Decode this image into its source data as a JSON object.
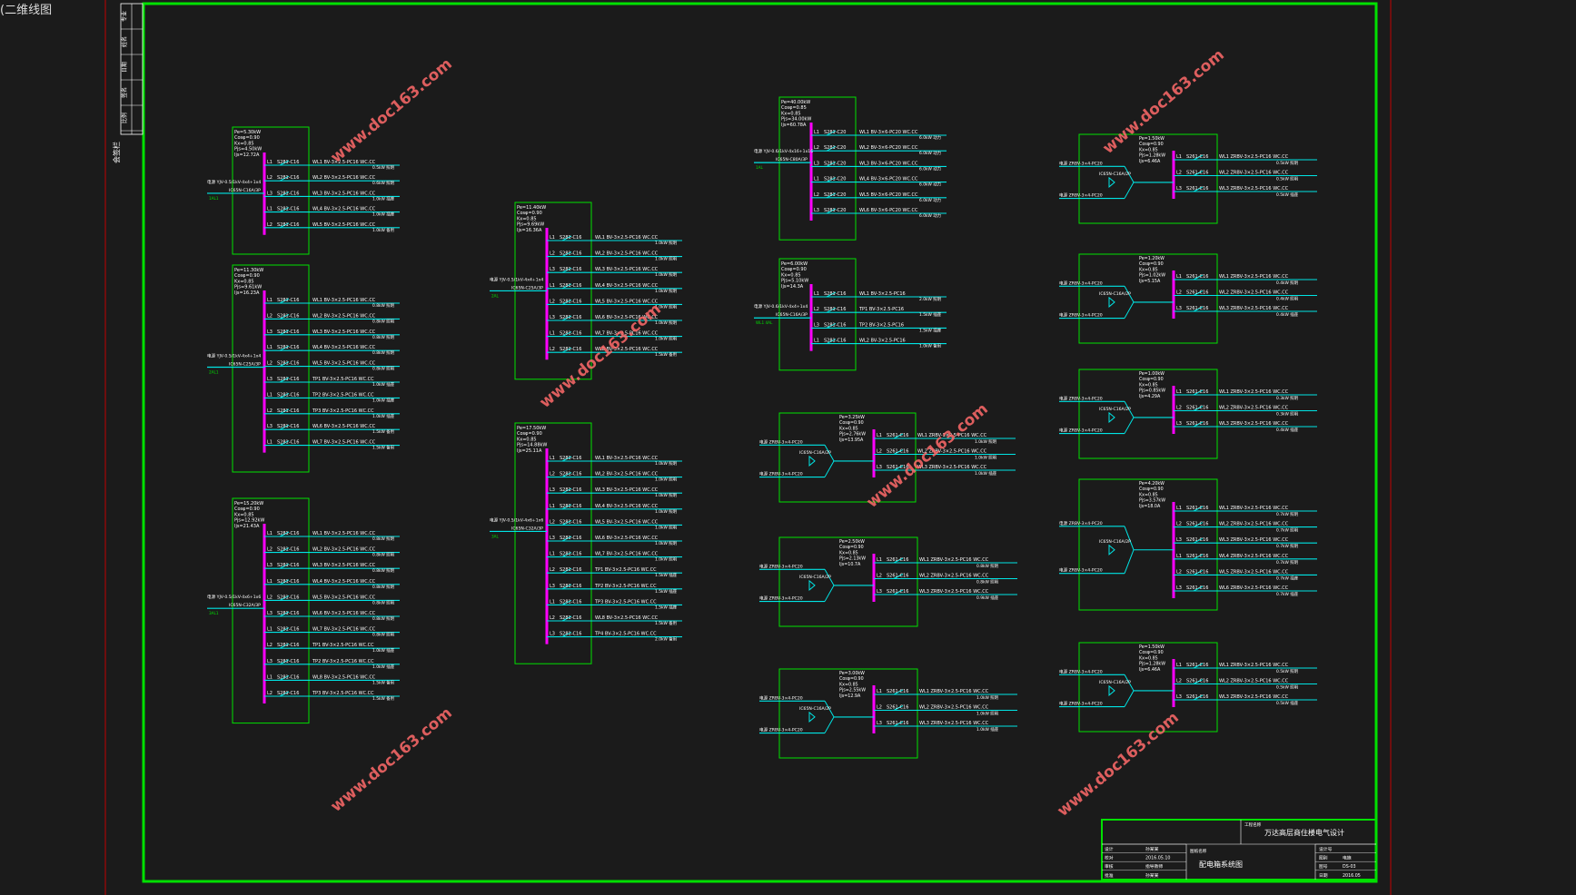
{
  "tab_label": "(二维线图",
  "colors": {
    "background": "#1b1b1b",
    "border": "#00e000",
    "busbar": "#ff00ff",
    "feeder": "#00e5e5",
    "text": "#ffffff",
    "watermark": "#ff6a6a",
    "sheet_edge": "#c00000"
  },
  "watermark": "www.doc163.com",
  "left_strip": {
    "label_side": "会签栏",
    "cells": [
      "专业",
      "姓名",
      "日期",
      "签名",
      "比例"
    ]
  },
  "panels": [
    {
      "id": "AL-1",
      "params": [
        "Pe=5.30kW",
        "Cosφ=0.90",
        "Kx=0.85",
        "Pjs=4.50kW",
        "Ijs=12.72A"
      ],
      "incoming": "电源 YJV-0.5/1kV-4x4+1x4",
      "main_breaker": "IC65N-C16A/3P",
      "input_label": "1AL1",
      "circuits": [
        {
          "phase": "L1",
          "breaker": "S281-C16",
          "cable": "WL1 BV-3×2.5-PC16 WC.CC",
          "load": "0.5kW 照明"
        },
        {
          "phase": "L2",
          "breaker": "S281-C16",
          "cable": "WL2 BV-3×2.5-PC16 WC.CC",
          "load": "0.6kW 照明"
        },
        {
          "phase": "L3",
          "breaker": "S281-C16",
          "cable": "WL3 BV-3×2.5-PC16 WC.CC",
          "load": "1.0kW 插座"
        },
        {
          "phase": "L1",
          "breaker": "S281-C16",
          "cable": "WL4 BV-3×2.5-PC16 WC.CC",
          "load": "1.0kW 插座"
        },
        {
          "phase": "L2",
          "breaker": "S281-C16",
          "cable": "WL5 BV-3×2.5-PC16 WC.CC",
          "load": "1.0kW 备用"
        }
      ]
    },
    {
      "id": "AL-2",
      "params": [
        "Pe=11.30kW",
        "Cosφ=0.90",
        "Kx=0.85",
        "Pjs=9.61kW",
        "Ijs=16.23A"
      ],
      "incoming": "电源 YJV-0.5/1kV-4x4+1x4",
      "main_breaker": "IC65N-C25A/3P",
      "input_label": "2AL1",
      "circuits": [
        {
          "phase": "L1",
          "breaker": "S281-C16",
          "cable": "WL1 BV-3×2.5-PC16 WC.CC",
          "load": "0.8kW 照明"
        },
        {
          "phase": "L2",
          "breaker": "S281-C16",
          "cable": "WL2 BV-3×2.5-PC16 WC.CC",
          "load": "0.8kW 照明"
        },
        {
          "phase": "L3",
          "breaker": "S281-C16",
          "cable": "WL3 BV-3×2.5-PC16 WC.CC",
          "load": "0.8kW 照明"
        },
        {
          "phase": "L1",
          "breaker": "S281-C16",
          "cable": "WL4 BV-3×2.5-PC16 WC.CC",
          "load": "0.8kW 照明"
        },
        {
          "phase": "L2",
          "breaker": "S281-C16",
          "cable": "WL5 BV-3×2.5-PC16 WC.CC",
          "load": "0.8kW 照明"
        },
        {
          "phase": "L3",
          "breaker": "S281-C16",
          "cable": "TP1 BV-3×2.5-PC16 WC.CC",
          "load": "1.0kW 插座"
        },
        {
          "phase": "L1",
          "breaker": "S281-C16",
          "cable": "TP2 BV-3×2.5-PC16 WC.CC",
          "load": "1.0kW 插座"
        },
        {
          "phase": "L2",
          "breaker": "S281-C16",
          "cable": "TP3 BV-3×2.5-PC16 WC.CC",
          "load": "1.0kW 插座"
        },
        {
          "phase": "L3",
          "breaker": "S281-C16",
          "cable": "WL6 BV-3×2.5-PC16 WC.CC",
          "load": "1.5kW 备用"
        },
        {
          "phase": "L1",
          "breaker": "S281-C16",
          "cable": "WL7 BV-3×2.5-PC16 WC.CC",
          "load": "1.5kW 备用"
        }
      ]
    },
    {
      "id": "AL-3",
      "params": [
        "Pe=15.20kW",
        "Cosφ=0.90",
        "Kx=0.85",
        "Pjs=12.92kW",
        "Ijs=21.43A"
      ],
      "incoming": "电源 YJV-0.5/1kV-4x6+1x6",
      "main_breaker": "IC65N-C32A/3P",
      "input_label": "3AL1",
      "circuits": [
        {
          "phase": "L1",
          "breaker": "S281-C16",
          "cable": "WL1 BV-3×2.5-PC16 WC.CC",
          "load": "0.8kW 照明"
        },
        {
          "phase": "L2",
          "breaker": "S281-C16",
          "cable": "WL2 BV-3×2.5-PC16 WC.CC",
          "load": "0.8kW 照明"
        },
        {
          "phase": "L3",
          "breaker": "S281-C16",
          "cable": "WL3 BV-3×2.5-PC16 WC.CC",
          "load": "0.8kW 照明"
        },
        {
          "phase": "L1",
          "breaker": "S281-C16",
          "cable": "WL4 BV-3×2.5-PC16 WC.CC",
          "load": "0.8kW 照明"
        },
        {
          "phase": "L2",
          "breaker": "S281-C16",
          "cable": "WL5 BV-3×2.5-PC16 WC.CC",
          "load": "0.8kW 照明"
        },
        {
          "phase": "L3",
          "breaker": "S281-C16",
          "cable": "WL6 BV-3×2.5-PC16 WC.CC",
          "load": "0.8kW 照明"
        },
        {
          "phase": "L1",
          "breaker": "S281-C16",
          "cable": "WL7 BV-3×2.5-PC16 WC.CC",
          "load": "0.8kW 照明"
        },
        {
          "phase": "L2",
          "breaker": "S281-C16",
          "cable": "TP1 BV-3×2.5-PC16 WC.CC",
          "load": "1.0kW 插座"
        },
        {
          "phase": "L3",
          "breaker": "S281-C16",
          "cable": "TP2 BV-3×2.5-PC16 WC.CC",
          "load": "1.0kW 插座"
        },
        {
          "phase": "L1",
          "breaker": "S281-C16",
          "cable": "WL8 BV-3×2.5-PC16 WC.CC",
          "load": "1.5kW 备用"
        },
        {
          "phase": "L2",
          "breaker": "S281-C16",
          "cable": "TP3 BV-3×2.5-PC16 WC.CC",
          "load": "1.5kW 备用"
        }
      ]
    },
    {
      "id": "AL-4",
      "params": [
        "Pe=11.40kW",
        "Cosφ=0.90",
        "Kx=0.85",
        "Pjs=9.69kW",
        "Ijs=16.36A"
      ],
      "incoming": "电源 YJV-0.5/1kV-4x4+1x4",
      "main_breaker": "IC65N-C25A/3P",
      "input_label": "2AL",
      "circuits": [
        {
          "phase": "L1",
          "breaker": "S281-C16",
          "cable": "WL1 BV-3×2.5-PC16 WC.CC",
          "load": "1.0kW 照明"
        },
        {
          "phase": "L2",
          "breaker": "S281-C16",
          "cable": "WL2 BV-3×2.5-PC16 WC.CC",
          "load": "1.0kW 照明"
        },
        {
          "phase": "L3",
          "breaker": "S281-C16",
          "cable": "WL3 BV-3×2.5-PC16 WC.CC",
          "load": "1.0kW 照明"
        },
        {
          "phase": "L1",
          "breaker": "S281-C16",
          "cable": "WL4 BV-3×2.5-PC16 WC.CC",
          "load": "1.0kW 照明"
        },
        {
          "phase": "L2",
          "breaker": "S281-C16",
          "cable": "WL5 BV-3×2.5-PC16 WC.CC",
          "load": "1.0kW 照明"
        },
        {
          "phase": "L3",
          "breaker": "S281-C16",
          "cable": "WL6 BV-3×2.5-PC16 WC.CC",
          "load": "1.0kW 照明"
        },
        {
          "phase": "L1",
          "breaker": "S281-C16",
          "cable": "WL7 BV-3×2.5-PC16 WC.CC",
          "load": "1.0kW 照明"
        },
        {
          "phase": "L2",
          "breaker": "S281-C16",
          "cable": "WL8 BV-3×2.5-PC16 WC.CC",
          "load": "1.5kW 备用"
        }
      ]
    },
    {
      "id": "AL-5",
      "params": [
        "Pe=17.50kW",
        "Cosφ=0.90",
        "Kx=0.85",
        "Pjs=14.88kW",
        "Ijs=25.11A"
      ],
      "incoming": "电源 YJV-0.5/1kV-4x6+1x6",
      "main_breaker": "IC65N-C32A/3P",
      "input_label": "3AL",
      "circuits": [
        {
          "phase": "L1",
          "breaker": "S281-C16",
          "cable": "WL1 BV-3×2.5-PC16 WC.CC",
          "load": "1.0kW 照明"
        },
        {
          "phase": "L2",
          "breaker": "S281-C16",
          "cable": "WL2 BV-3×2.5-PC16 WC.CC",
          "load": "1.0kW 照明"
        },
        {
          "phase": "L3",
          "breaker": "S281-C16",
          "cable": "WL3 BV-3×2.5-PC16 WC.CC",
          "load": "1.0kW 照明"
        },
        {
          "phase": "L1",
          "breaker": "S281-C16",
          "cable": "WL4 BV-3×2.5-PC16 WC.CC",
          "load": "1.0kW 照明"
        },
        {
          "phase": "L2",
          "breaker": "S281-C16",
          "cable": "WL5 BV-3×2.5-PC16 WC.CC",
          "load": "1.0kW 照明"
        },
        {
          "phase": "L3",
          "breaker": "S281-C16",
          "cable": "WL6 BV-3×2.5-PC16 WC.CC",
          "load": "1.0kW 照明"
        },
        {
          "phase": "L1",
          "breaker": "S281-C16",
          "cable": "WL7 BV-3×2.5-PC16 WC.CC",
          "load": "1.0kW 照明"
        },
        {
          "phase": "L2",
          "breaker": "S281-C16",
          "cable": "TP1 BV-3×2.5-PC16 WC.CC",
          "load": "1.5kW 插座"
        },
        {
          "phase": "L3",
          "breaker": "S281-C16",
          "cable": "TP2 BV-3×2.5-PC16 WC.CC",
          "load": "1.5kW 插座"
        },
        {
          "phase": "L1",
          "breaker": "S281-C16",
          "cable": "TP3 BV-3×2.5-PC16 WC.CC",
          "load": "1.5kW 插座"
        },
        {
          "phase": "L2",
          "breaker": "S281-C16",
          "cable": "WL8 BV-3×2.5-PC16 WC.CC",
          "load": "1.5kW 备用"
        },
        {
          "phase": "L3",
          "breaker": "S281-C16",
          "cable": "TP4 BV-3×2.5-PC16 WC.CC",
          "load": "2.0kW 备用"
        }
      ]
    },
    {
      "id": "AL-6",
      "params": [
        "Pe=40.00kW",
        "Cosφ=0.85",
        "Kx=0.85",
        "Pjs=34.00kW",
        "Ijs=60.78A"
      ],
      "incoming": "电源 YJV-0.6/1kV-4x16+1x16",
      "main_breaker": "IC65N-C80A/3P",
      "input_label": "1AL",
      "circuits": [
        {
          "phase": "L1",
          "breaker": "S281-C20",
          "cable": "WL1 BV-3×6-PC20 WC.CC",
          "load": "6.0kW 动力"
        },
        {
          "phase": "L2",
          "breaker": "S281-C20",
          "cable": "WL2 BV-3×6-PC20 WC.CC",
          "load": "6.0kW 动力"
        },
        {
          "phase": "L3",
          "breaker": "S281-C20",
          "cable": "WL3 BV-3×6-PC20 WC.CC",
          "load": "6.0kW 动力"
        },
        {
          "phase": "L1",
          "breaker": "S281-C20",
          "cable": "WL4 BV-3×6-PC20 WC.CC",
          "load": "6.0kW 动力"
        },
        {
          "phase": "L2",
          "breaker": "S281-C20",
          "cable": "WL5 BV-3×6-PC20 WC.CC",
          "load": "6.0kW 动力"
        },
        {
          "phase": "L3",
          "breaker": "S281-C20",
          "cable": "WL6 BV-3×6-PC20 WC.CC",
          "load": "6.0kW 动力"
        }
      ]
    },
    {
      "id": "AL-7",
      "params": [
        "Pe=6.00kW",
        "Cosφ=0.90",
        "Kx=0.85",
        "Pjs=5.10kW",
        "Ijs=14.3A"
      ],
      "incoming": "电源 YJV-0.6/1kV-4x4+1x4",
      "main_breaker": "IC65N-C16A/3P",
      "input_label": "WL1 4AL",
      "circuits": [
        {
          "phase": "L1",
          "breaker": "S281-C16",
          "cable": "WL1 BV-3×2.5-PC16",
          "load": "2.0kW 照明"
        },
        {
          "phase": "L2",
          "breaker": "S281-C16",
          "cable": "TP1 BV-3×2.5-PC16",
          "load": "1.5kW 插座"
        },
        {
          "phase": "L3",
          "breaker": "S281-C16",
          "cable": "TP2 BV-3×2.5-PC16",
          "load": "1.5kW 插座"
        },
        {
          "phase": "L1",
          "breaker": "S281-C16",
          "cable": "WL2 BV-3×2.5-PC16",
          "load": "1.0kW 备用"
        }
      ]
    }
  ],
  "small_panels": [
    {
      "id": "S1",
      "params": [
        "Pe=3.25kW",
        "Cosφ=0.90",
        "Kx=0.85",
        "Pjs=2.76kW",
        "Ijs=13.95A"
      ],
      "feeds": [
        "电源 ZRBV-3×4-PC20",
        "电源 ZRBV-3×4-PC20"
      ],
      "switch": "IC65N-C16A/2P",
      "circuits": [
        {
          "phase": "L1",
          "breaker": "S261-C16",
          "cable": "WL1 ZRBV-3×2.5-PC16 WC.CC",
          "load": "1.0kW 照明"
        },
        {
          "phase": "L2",
          "breaker": "S261-C16",
          "cable": "WL2 ZRBV-3×2.5-PC16 WC.CC",
          "load": "1.0kW 照明"
        },
        {
          "phase": "L3",
          "breaker": "S261-C16",
          "cable": "WL3 ZRBV-3×2.5-PC16 WC.CC",
          "load": "1.0kW 插座"
        }
      ]
    },
    {
      "id": "S2",
      "params": [
        "Pe=2.50kW",
        "Cosφ=0.90",
        "Kx=0.85",
        "Pjs=2.13kW",
        "Ijs=10.7A"
      ],
      "feeds": [
        "电源 ZRBV-3×4-PC20",
        "电源 ZRBV-3×4-PC20"
      ],
      "switch": "IC65N-C16A/2P",
      "circuits": [
        {
          "phase": "L1",
          "breaker": "S261-C16",
          "cable": "WL1 ZRBV-3×2.5-PC16 WC.CC",
          "load": "0.8kW 照明"
        },
        {
          "phase": "L2",
          "breaker": "S261-C16",
          "cable": "WL2 ZRBV-3×2.5-PC16 WC.CC",
          "load": "0.8kW 照明"
        },
        {
          "phase": "L3",
          "breaker": "S261-C16",
          "cable": "WL3 ZRBV-3×2.5-PC16 WC.CC",
          "load": "0.9kW 插座"
        }
      ]
    },
    {
      "id": "S3",
      "params": [
        "Pe=3.00kW",
        "Cosφ=0.90",
        "Kx=0.85",
        "Pjs=2.55kW",
        "Ijs=12.9A"
      ],
      "feeds": [
        "电源 ZRBV-3×4-PC20",
        "电源 ZRBV-3×4-PC20"
      ],
      "switch": "IC65N-C16A/2P",
      "circuits": [
        {
          "phase": "L1",
          "breaker": "S261-C16",
          "cable": "WL1 ZRBV-3×2.5-PC16 WC.CC",
          "load": "1.0kW 照明"
        },
        {
          "phase": "L2",
          "breaker": "S261-C16",
          "cable": "WL2 ZRBV-3×2.5-PC16 WC.CC",
          "load": "1.0kW 照明"
        },
        {
          "phase": "L3",
          "breaker": "S261-C16",
          "cable": "WL3 ZRBV-3×2.5-PC16 WC.CC",
          "load": "1.0kW 插座"
        }
      ]
    },
    {
      "id": "S4",
      "params": [
        "Pe=1.50kW",
        "Cosφ=0.90",
        "Kx=0.85",
        "Pjs=1.28kW",
        "Ijs=6.46A"
      ],
      "feeds": [
        "电源 ZRBV-3×4-PC20",
        "电源 ZRBV-3×4-PC20"
      ],
      "switch": "IC65N-C16A/2P",
      "circuits": [
        {
          "phase": "L1",
          "breaker": "S261-C16",
          "cable": "WL1 ZRBV-3×2.5-PC16 WC.CC",
          "load": "0.5kW 照明"
        },
        {
          "phase": "L2",
          "breaker": "S261-C16",
          "cable": "WL2 ZRBV-3×2.5-PC16 WC.CC",
          "load": "0.5kW 照明"
        },
        {
          "phase": "L3",
          "breaker": "S261-C16",
          "cable": "WL3 ZRBV-3×2.5-PC16 WC.CC",
          "load": "0.5kW 插座"
        }
      ]
    },
    {
      "id": "S5",
      "params": [
        "Pe=1.20kW",
        "Cosφ=0.90",
        "Kx=0.85",
        "Pjs=1.02kW",
        "Ijs=5.15A"
      ],
      "feeds": [
        "电源 ZRBV-3×4-PC20",
        "电源 ZRBV-3×4-PC20"
      ],
      "switch": "IC65N-C16A/2P",
      "circuits": [
        {
          "phase": "L1",
          "breaker": "S261-C16",
          "cable": "WL1 ZRBV-3×2.5-PC16 WC.CC",
          "load": "0.4kW 照明"
        },
        {
          "phase": "L2",
          "breaker": "S261-C16",
          "cable": "WL2 ZRBV-3×2.5-PC16 WC.CC",
          "load": "0.4kW 照明"
        },
        {
          "phase": "L3",
          "breaker": "S261-C16",
          "cable": "WL3 ZRBV-3×2.5-PC16 WC.CC",
          "load": "0.4kW 插座"
        }
      ]
    },
    {
      "id": "S6",
      "params": [
        "Pe=1.00kW",
        "Cosφ=0.90",
        "Kx=0.85",
        "Pjs=0.85kW",
        "Ijs=4.29A"
      ],
      "feeds": [
        "电源 ZRBV-3×4-PC20",
        "电源 ZRBV-3×4-PC20"
      ],
      "switch": "IC65N-C16A/2P",
      "circuits": [
        {
          "phase": "L1",
          "breaker": "S261-C16",
          "cable": "WL1 ZRBV-3×2.5-PC16 WC.CC",
          "load": "0.3kW 照明"
        },
        {
          "phase": "L2",
          "breaker": "S261-C16",
          "cable": "WL2 ZRBV-3×2.5-PC16 WC.CC",
          "load": "0.3kW 照明"
        },
        {
          "phase": "L3",
          "breaker": "S261-C16",
          "cable": "WL3 ZRBV-3×2.5-PC16 WC.CC",
          "load": "0.4kW 插座"
        }
      ]
    },
    {
      "id": "S7",
      "params": [
        "Pe=4.20kW",
        "Cosφ=0.90",
        "Kx=0.85",
        "Pjs=3.57kW",
        "Ijs=18.0A"
      ],
      "feeds": [
        "电源 ZRBV-3×4-PC20",
        "电源 ZRBV-3×4-PC20"
      ],
      "switch": "IC65N-C16A/2P",
      "circuits": [
        {
          "phase": "L1",
          "breaker": "S261-C16",
          "cable": "WL1 ZRBV-3×2.5-PC16 WC.CC",
          "load": "0.7kW 照明"
        },
        {
          "phase": "L2",
          "breaker": "S261-C16",
          "cable": "WL2 ZRBV-3×2.5-PC16 WC.CC",
          "load": "0.7kW 照明"
        },
        {
          "phase": "L3",
          "breaker": "S261-C16",
          "cable": "WL3 ZRBV-3×2.5-PC16 WC.CC",
          "load": "0.7kW 照明"
        },
        {
          "phase": "L1",
          "breaker": "S261-C16",
          "cable": "WL4 ZRBV-3×2.5-PC16 WC.CC",
          "load": "0.7kW 照明"
        },
        {
          "phase": "L2",
          "breaker": "S261-C16",
          "cable": "WL5 ZRBV-3×2.5-PC16 WC.CC",
          "load": "0.7kW 插座"
        },
        {
          "phase": "L3",
          "breaker": "S261-C16",
          "cable": "WL6 ZRBV-3×2.5-PC16 WC.CC",
          "load": "0.7kW 插座"
        }
      ]
    },
    {
      "id": "S8",
      "params": [
        "Pe=1.50kW",
        "Cosφ=0.90",
        "Kx=0.85",
        "Pjs=1.28kW",
        "Ijs=6.46A"
      ],
      "feeds": [
        "电源 ZRBV-3×4-PC20",
        "电源 ZRBV-3×4-PC20"
      ],
      "switch": "IC65N-C16A/2P",
      "circuits": [
        {
          "phase": "L1",
          "breaker": "S261-C16",
          "cable": "WL1 ZRBV-3×2.5-PC16 WC.CC",
          "load": "0.5kW 照明"
        },
        {
          "phase": "L2",
          "breaker": "S261-C16",
          "cable": "WL2 ZRBV-3×2.5-PC16 WC.CC",
          "load": "0.5kW 照明"
        },
        {
          "phase": "L3",
          "breaker": "S261-C16",
          "cable": "WL3 ZRBV-3×2.5-PC16 WC.CC",
          "load": "0.5kW 插座"
        }
      ]
    }
  ],
  "title_block": {
    "project_label": "工程名称",
    "project": "万达高层商住楼电气设计",
    "drawing_label": "图纸名称",
    "drawing": "配电箱系统图",
    "left_rows": [
      {
        "role": "设计",
        "value": "孙某某"
      },
      {
        "role": "校对",
        "value": "2016.05.10"
      },
      {
        "role": "审核",
        "value": "指导教师"
      },
      {
        "role": "批准",
        "value": "孙某某"
      }
    ],
    "right_rows": [
      {
        "key": "设计号",
        "value": ""
      },
      {
        "key": "图别",
        "value": "电施"
      },
      {
        "key": "图号",
        "value": "DS-03"
      },
      {
        "key": "日期",
        "value": "2016.05"
      }
    ]
  }
}
